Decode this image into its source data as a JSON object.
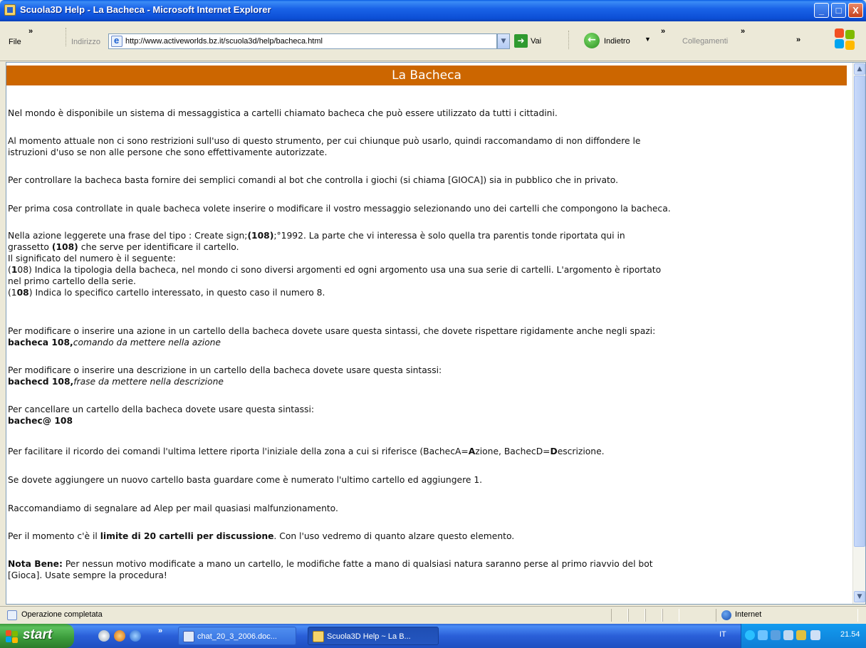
{
  "window": {
    "title": "Scuola3D Help - La Bacheca - Microsoft Internet Explorer",
    "min_glyph": "_",
    "max_glyph": "□",
    "close_glyph": "X"
  },
  "toolbar": {
    "file_label": "File",
    "address_label": "Indirizzo",
    "url": "http://www.activeworlds.bz.it/scuola3d/help/bacheca.html",
    "go_label": "Vai",
    "back_label": "Indietro",
    "links_label": "Collegamenti",
    "more_glyph": "»"
  },
  "page": {
    "heading": "La Bacheca",
    "p1": "Nel mondo è disponibile un sistema di messaggistica a cartelli chiamato bacheca che può essere utilizzato da tutti i cittadini.",
    "p2_line1": "Al momento attuale non ci sono restrizioni sull'uso di questo strumento, per cui chiunque può usarlo, quindi raccomandamo di non diffondere le",
    "p2_line2": "istruzioni d'uso se non alle persone che sono effettivamente autorizzate.",
    "p3": "Per controllare la bacheca basta fornire dei semplici comandi al bot che controlla i giochi (si chiama [GIOCA]) sia in pubblico che in privato.",
    "p4": "Per prima cosa controllate in quale bacheca volete inserire o modificare il vostro messaggio selezionando uno dei cartelli che compongono la bacheca.",
    "p5_a": "Nella azione leggerete una frase del tipo : Create sign;",
    "p5_b": "(108)",
    "p5_c": ";°1992. La parte che vi interessa è solo quella tra parentis tonde riportata qui in",
    "p5_d": "grassetto ",
    "p5_e": "(108)",
    "p5_f": " che serve per identificare il cartello.",
    "p5_line3": "Il significato del numero è il seguente:",
    "p5_g1": "(",
    "p5_g2": "1",
    "p5_g3": "08) Indica la tipologia della bacheca, nel mondo ci sono diversi argomenti ed ogni argomento usa una sua serie di cartelli. L'argomento è riportato",
    "p5_line5": "nel primo cartello della serie.",
    "p5_h1": "(1",
    "p5_h2": "08",
    "p5_h3": ") Indica lo specifico cartello interessato, in questo caso il numero 8.",
    "p6_line1": "Per modificare o inserire una azione in un cartello della bacheca dovete usare questa sintassi, che dovete rispettare rigidamente anche negli spazi:",
    "p6_cmd": "bacheca 108,",
    "p6_cmd_rest": "comando da mettere nella azione",
    "p7_line1": "Per modificare o inserire una descrizione in un cartello della bacheca dovete usare questa sintassi:",
    "p7_cmd": "bachecd 108,",
    "p7_cmd_rest": "frase da mettere nella descrizione",
    "p8_line1": "Per cancellare un cartello della bacheca dovete usare questa sintassi:",
    "p8_cmd": "bachec@ 108",
    "p9_a": "Per facilitare il ricordo dei comandi l'ultima lettere riporta l'iniziale della zona a cui si riferisce (BachecA=",
    "p9_b": "A",
    "p9_c": "zione, BachecD=",
    "p9_d": "D",
    "p9_e": "escrizione.",
    "p10": "Se dovete aggiungere un nuovo cartello basta guardare come è numerato l'ultimo cartello ed aggiungere 1.",
    "p11": "Raccomandiamo di segnalare ad Alep per mail quasiasi malfunzionamento.",
    "p12_a": "Per il momento c'è il ",
    "p12_b": "limite di 20 cartelli per discussione",
    "p12_c": ". Con l'uso vedremo di quanto alzare questo elemento.",
    "p13_a": "Nota Bene:",
    "p13_b": " Per nessun motivo modificate a mano un cartello, le modifiche fatte a mano di qualsiasi natura saranno perse al primo riavvio del bot",
    "p13_line2": "[Gioca]. Usate sempre la procedura!"
  },
  "statusbar": {
    "status": "Operazione completata",
    "zone": "Internet"
  },
  "taskbar": {
    "start_label": "start",
    "task1": "chat_20_3_2006.doc...",
    "task2": "Scuola3D Help ~ La B...",
    "lang": "IT",
    "clock": "21.54"
  },
  "colors": {
    "heading_bg": "#cc6600",
    "titlebar": "#0c4fd6",
    "start_green": "#3a9a3a"
  }
}
